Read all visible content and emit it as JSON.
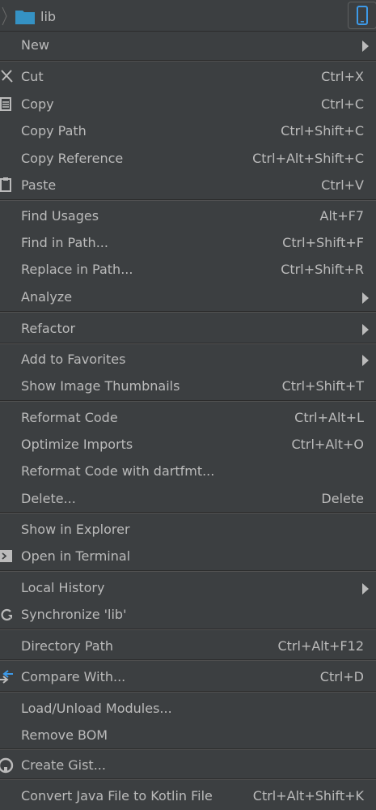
{
  "breadcrumb": {
    "label": "lib"
  },
  "menu": {
    "items": [
      {
        "label": "New",
        "shortcut": ""
      },
      {
        "label": "Cut",
        "shortcut": "Ctrl+X"
      },
      {
        "label": "Copy",
        "shortcut": "Ctrl+C"
      },
      {
        "label": "Copy Path",
        "shortcut": "Ctrl+Shift+C"
      },
      {
        "label": "Copy Reference",
        "shortcut": "Ctrl+Alt+Shift+C"
      },
      {
        "label": "Paste",
        "shortcut": "Ctrl+V"
      },
      {
        "label": "Find Usages",
        "shortcut": "Alt+F7"
      },
      {
        "label": "Find in Path...",
        "shortcut": "Ctrl+Shift+F"
      },
      {
        "label": "Replace in Path...",
        "shortcut": "Ctrl+Shift+R"
      },
      {
        "label": "Analyze",
        "shortcut": ""
      },
      {
        "label": "Refactor",
        "shortcut": ""
      },
      {
        "label": "Add to Favorites",
        "shortcut": ""
      },
      {
        "label": "Show Image Thumbnails",
        "shortcut": "Ctrl+Shift+T"
      },
      {
        "label": "Reformat Code",
        "shortcut": "Ctrl+Alt+L"
      },
      {
        "label": "Optimize Imports",
        "shortcut": "Ctrl+Alt+O"
      },
      {
        "label": "Reformat Code with dartfmt...",
        "shortcut": ""
      },
      {
        "label": "Delete...",
        "shortcut": "Delete"
      },
      {
        "label": "Show in Explorer",
        "shortcut": ""
      },
      {
        "label": "Open in Terminal",
        "shortcut": ""
      },
      {
        "label": "Local History",
        "shortcut": ""
      },
      {
        "label": "Synchronize 'lib'",
        "shortcut": ""
      },
      {
        "label": "Directory Path",
        "shortcut": "Ctrl+Alt+F12"
      },
      {
        "label": "Compare With...",
        "shortcut": "Ctrl+D"
      },
      {
        "label": "Load/Unload Modules...",
        "shortcut": ""
      },
      {
        "label": "Remove BOM",
        "shortcut": ""
      },
      {
        "label": "Create Gist...",
        "shortcut": ""
      },
      {
        "label": "Convert Java File to Kotlin File",
        "shortcut": "Ctrl+Alt+Shift+K"
      }
    ]
  },
  "colors": {
    "background": "#3c3f41",
    "text": "#bbbbbb",
    "separator_dark": "#2b2b2b",
    "separator_light": "#515151",
    "folder_blue": "#3592c4",
    "device_blue": "#3d9ae8"
  }
}
